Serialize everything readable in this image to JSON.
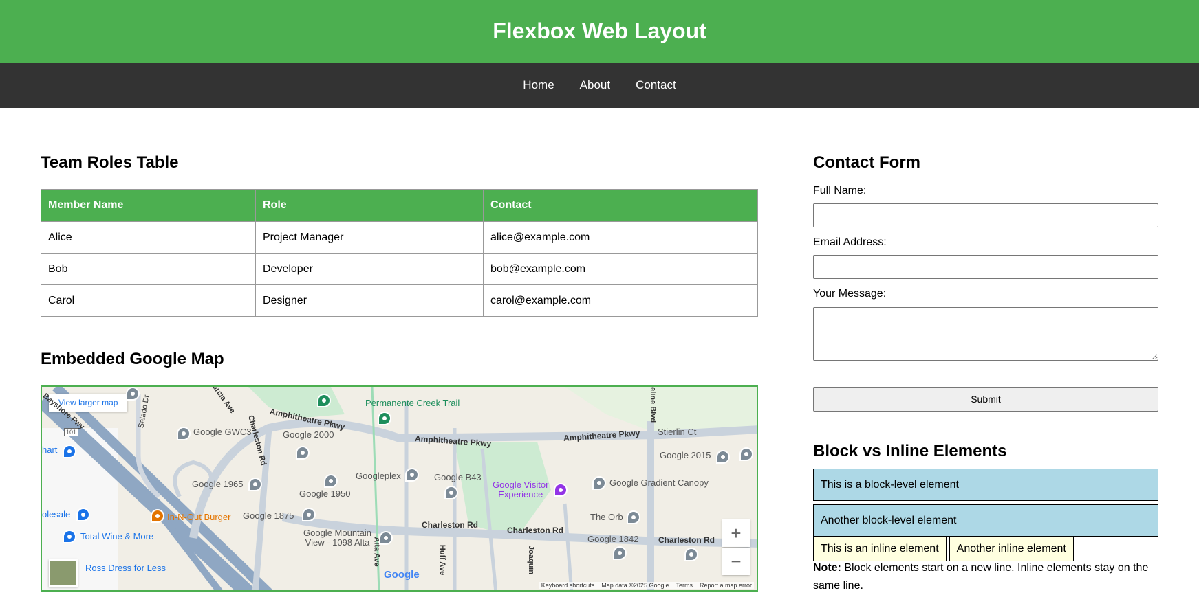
{
  "header": {
    "title": "Flexbox Web Layout"
  },
  "nav": {
    "items": [
      "Home",
      "About",
      "Contact"
    ]
  },
  "team": {
    "heading": "Team Roles Table",
    "columns": [
      "Member Name",
      "Role",
      "Contact"
    ],
    "rows": [
      [
        "Alice",
        "Project Manager",
        "alice@example.com"
      ],
      [
        "Bob",
        "Developer",
        "bob@example.com"
      ],
      [
        "Carol",
        "Designer",
        "carol@example.com"
      ]
    ]
  },
  "map": {
    "heading": "Embedded Google Map",
    "larger_link": "View larger map",
    "zoom_in": "+",
    "zoom_out": "−",
    "logo": "Google",
    "footer": [
      "Keyboard shortcuts",
      "Map data ©2025 Google",
      "Terms",
      "Report a map error"
    ],
    "labels": {
      "trail": "Permanente Creek Trail",
      "amph1": "Amphitheatre Pkwy",
      "amph2": "Amphitheatre Pkwy",
      "amph3": "Amphitheatre Pkwy",
      "gwc3": "Google GWC3",
      "g2000": "Google 2000",
      "stierlin": "Stierlin Ct",
      "g2015": "Google 2015",
      "googleplex": "Googleplex",
      "gb43": "Google B43",
      "g1965": "Google 1965",
      "g1950": "Google 1950",
      "visitor": "Google Visitor\nExperience",
      "canopy": "Google Gradient Canopy",
      "innout": "In-N-Out Burger",
      "g1875": "Google 1875",
      "charleston1": "Charleston Rd",
      "charleston2": "Charleston Rd",
      "charleston3": "Charleston Rd",
      "theorb": "The Orb",
      "g1842": "Google 1842",
      "mountainview": "Google Mountain\nView - 1098 Alta",
      "totalwine": "Total Wine & More",
      "rossdress": "Ross Dress for Less",
      "wholesale": "olesale",
      "mart": "hart",
      "salado": "Salado Dr",
      "charlestonRdV": "Charleston Rd",
      "garcia": "arcia Ave",
      "shoreline": "reline Blvd",
      "alta": "Alta Ave",
      "huff": "Huff Ave",
      "joaquin": "Joaquin",
      "bayshore": "Bayshore Fwy",
      "hwy": "101"
    }
  },
  "contact": {
    "heading": "Contact Form",
    "name_label": "Full Name:",
    "email_label": "Email Address:",
    "message_label": "Your Message:",
    "submit": "Submit"
  },
  "blockinline": {
    "heading": "Block vs Inline Elements",
    "block1": "This is a block-level element",
    "block2": "Another block-level element",
    "inline1": "This is an inline element",
    "inline2": "Another inline element",
    "note_bold": "Note:",
    "note_text": " Block elements start on a new line. Inline elements stay on the same line."
  },
  "colors": {
    "header_bg": "#4caf50",
    "nav_bg": "#333333",
    "block_bg": "#add8e6",
    "inline_bg": "#ffffe0"
  }
}
